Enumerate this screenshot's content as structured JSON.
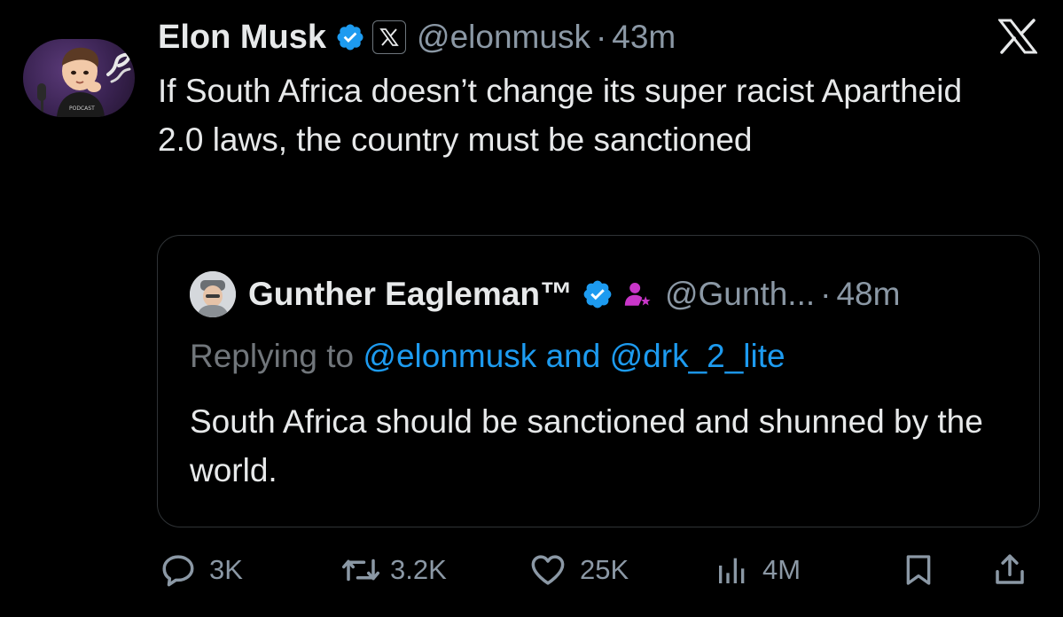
{
  "tweet": {
    "author_name": "Elon Musk",
    "handle": "@elonmusk",
    "separator": "·",
    "time": "43m",
    "text": "If South Africa doesn’t change its super racist Apartheid 2.0 laws, the country must be sanctioned",
    "affiliate_badge_glyph": "𝕏",
    "verified_color": "#1d9bf0",
    "icons": [
      "verified-badge-icon",
      "x-affiliate-icon",
      "x-logo-icon"
    ]
  },
  "quote": {
    "author_name": "Gunther Eagleman™",
    "handle": "@Gunth...",
    "separator": "·",
    "time": "48m",
    "replying_prefix": "Replying to",
    "mention_1": "@elonmusk",
    "replying_and": "and",
    "mention_2": "@drk_2_lite",
    "text": "South Africa should be sanctioned and shunned by the world.",
    "person_icon_color": "#c936c9",
    "mention_color": "#1d9bf0",
    "icons": [
      "verified-badge-icon",
      "person-star-icon"
    ]
  },
  "actions": {
    "replies": "3K",
    "reposts": "3.2K",
    "likes": "25K",
    "views": "4M",
    "icons": [
      "reply-icon",
      "repost-icon",
      "like-icon",
      "views-icon",
      "bookmark-icon",
      "share-icon"
    ]
  },
  "colors": {
    "background": "#000000",
    "text_primary": "#e7e9ea",
    "text_secondary": "#8b98a5",
    "border": "#2f3336"
  }
}
